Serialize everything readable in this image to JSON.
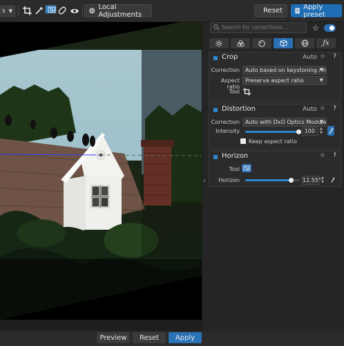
{
  "toolbar": {
    "mode_dropdown": "s",
    "local_adjustments_label": "Local Adjustments",
    "reset_label": "Reset",
    "apply_preset_label": "Apply preset"
  },
  "panel": {
    "search_placeholder": "Search for corrections..."
  },
  "crop": {
    "title": "Crop",
    "auto": "Auto",
    "correction_label": "Correction",
    "correction_value": "Auto based on keystoning / h...",
    "aspect_label": "Aspect ratio",
    "aspect_value": "Preserve aspect ratio",
    "tool_label": "Tool"
  },
  "distortion": {
    "title": "Distortion",
    "auto": "Auto",
    "correction_label": "Correction",
    "correction_value": "Auto with DxO Optics Module",
    "intensity_label": "Intensity",
    "intensity_value": "100",
    "intensity_fraction": 1.0,
    "keep_aspect_label": "Keep aspect ratio"
  },
  "horizon": {
    "title": "Horizon",
    "tool_label": "Tool",
    "horizon_label": "Horizon",
    "horizon_value": "12.55°",
    "horizon_fraction": 0.86
  },
  "bottom": {
    "preview_label": "Preview",
    "reset_label": "Reset",
    "apply_label": "Apply"
  },
  "colors": {
    "accent": "#2c70b4",
    "panel_bg": "#252525",
    "card_bg": "#2b2b2b"
  }
}
